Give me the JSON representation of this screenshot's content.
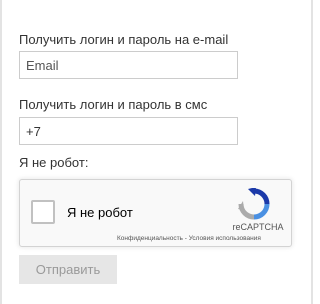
{
  "email_section": {
    "label": "Получить логин и пароль на e-mail",
    "placeholder": "Email",
    "value": ""
  },
  "sms_section": {
    "label": "Получить логин и пароль в смс",
    "value": "+7"
  },
  "robot_section": {
    "label": "Я не робот:"
  },
  "recaptcha": {
    "checkbox_label": "Я не робот",
    "brand": "reCAPTCHA",
    "privacy_link": "Конфиденциальность",
    "separator": " - ",
    "terms_link": "Условия использования",
    "checked": false,
    "colors": {
      "arrow_blue": "#1c3aa9",
      "arrow_light_blue": "#4a90e2",
      "arrow_gray": "#ababab"
    }
  },
  "submit": {
    "label": "Отправить",
    "disabled": true
  }
}
